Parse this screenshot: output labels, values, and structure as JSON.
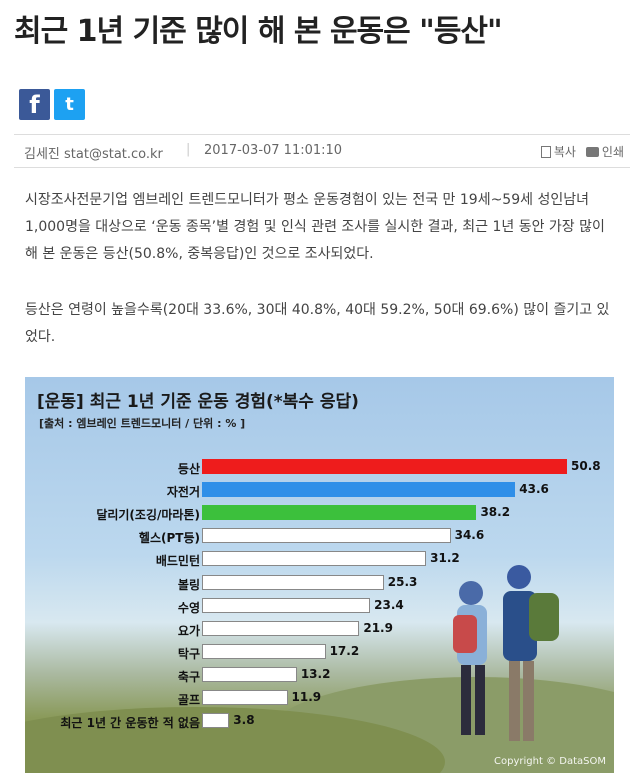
{
  "article": {
    "title": "최근 1년 기준 많이 해 본 운동은 \"등산\"",
    "author": "김세진 stat@stat.co.kr",
    "separator": "|",
    "date": "2017-03-07 11:01:10",
    "copy_label": "복사",
    "print_label": "인쇄",
    "paragraph1": "시장조사전문기업 엠브레인 트렌드모니터가 평소 운동경험이 있는 전국 만 19세~59세 성인남녀 1,000명을 대상으로 ‘운동 종목’별 경험 및 인식 관련 조사를 실시한 결과, 최근 1년 동안 가장 많이 해 본 운동은 등산(50.8%, 중복응답)인 것으로 조사되었다.",
    "paragraph2": "등산은 연령이 높을수록(20대 33.6%, 30대 40.8%, 40대 59.2%, 50대 69.6%) 많이 즐기고 있었다."
  },
  "share": {
    "facebook": "f",
    "twitter": "t"
  },
  "colors": {
    "red": "#ee1c1c",
    "blue": "#2f8fe8",
    "green": "#3cc03c",
    "white": "#ffffff"
  },
  "chart_data": {
    "type": "bar",
    "orientation": "horizontal",
    "title": "[운동] 최근 1년 기준 운동 경험(*복수 응답)",
    "source": "[출처 : 엠브레인 트렌드모니터 / 단위 : % ]",
    "categories": [
      "등산",
      "자전거",
      "달리기(조깅/마라톤)",
      "헬스(PT등)",
      "배드민턴",
      "볼링",
      "수영",
      "요가",
      "탁구",
      "축구",
      "골프",
      "최근 1년 간 운동한 적 없음"
    ],
    "values": [
      50.8,
      43.6,
      38.2,
      34.6,
      31.2,
      25.3,
      23.4,
      21.9,
      17.2,
      13.2,
      11.9,
      3.8
    ],
    "labels": [
      "50.8",
      "43.6",
      "38.2",
      "34.6",
      "31.2",
      "25.3",
      "23.4",
      "21.9",
      "17.2",
      "13.2",
      "11.9",
      "3.8"
    ],
    "bar_colors": [
      "#ee1c1c",
      "#2f8fe8",
      "#3cc03c",
      "#ffffff",
      "#ffffff",
      "#ffffff",
      "#ffffff",
      "#ffffff",
      "#ffffff",
      "#ffffff",
      "#ffffff",
      "#ffffff"
    ],
    "xlim": [
      0,
      60
    ],
    "grid": false,
    "watermark": "Copyright © DataSOM"
  }
}
